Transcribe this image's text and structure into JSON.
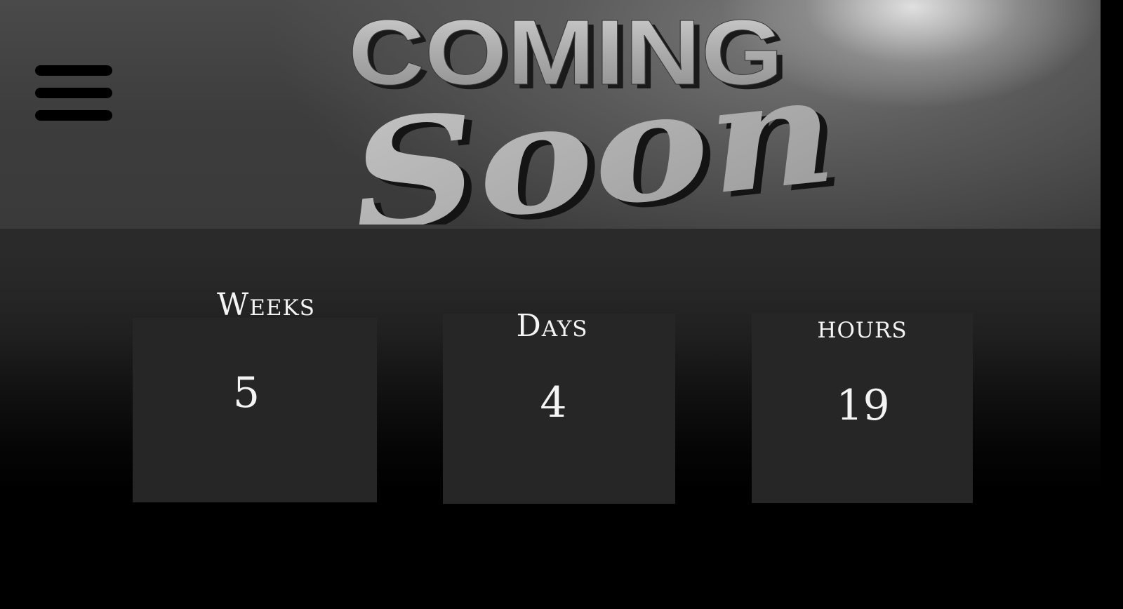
{
  "header": {
    "logo": {
      "line1": "COMING",
      "line2": "Soon"
    },
    "menu_icon": "hamburger-menu-icon"
  },
  "countdown": {
    "weeks": {
      "label": "Weeks",
      "value": "5"
    },
    "days": {
      "label": "Days",
      "value": "4"
    },
    "hours": {
      "label": "hours",
      "value": "19"
    }
  },
  "colors": {
    "card_bg": "#262626",
    "text": "#f4f4f4",
    "page_bg": "#000000"
  }
}
